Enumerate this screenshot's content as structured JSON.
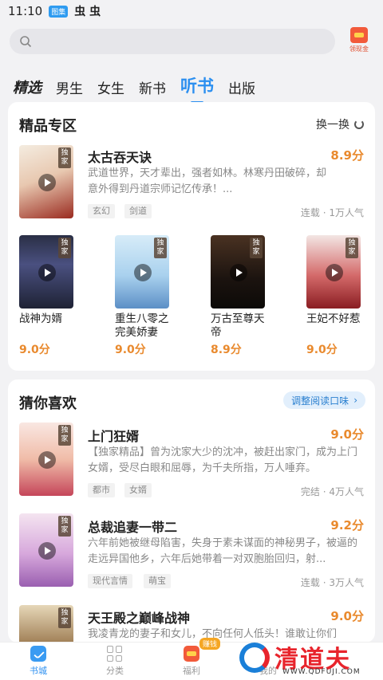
{
  "status_bar": {
    "time": "11:10",
    "app_tag": "图集",
    "icons": "虫 虫"
  },
  "search": {
    "placeholder": ""
  },
  "signin": {
    "label": "领现金"
  },
  "tabs": [
    {
      "label": "精选"
    },
    {
      "label": "男生"
    },
    {
      "label": "女生"
    },
    {
      "label": "新书"
    },
    {
      "label": "听书"
    },
    {
      "label": "出版"
    }
  ],
  "premium": {
    "title": "精品专区",
    "action": "换一换",
    "featured": {
      "title": "太古吞天诀",
      "score": "8.9分",
      "desc": "武道世界，天才辈出，强者如林。林寒丹田破碎，却意外得到丹道宗师记忆传承！...",
      "tags": [
        "玄幻",
        "剑道"
      ],
      "meta": "连载 · 1万人气",
      "exclusive": "独家"
    },
    "grid": [
      {
        "title": "战神为婿",
        "score": "9.0分",
        "exclusive": "独家"
      },
      {
        "title": "重生八零之完美娇妻",
        "score": "9.0分",
        "exclusive": "独家"
      },
      {
        "title": "万古至尊天帝",
        "score": "8.9分",
        "exclusive": "独家"
      },
      {
        "title": "王妃不好惹",
        "score": "9.0分",
        "exclusive": "独家"
      }
    ]
  },
  "recommend": {
    "title": "猜你喜欢",
    "action": "调整阅读口味",
    "books": [
      {
        "title": "上门狂婿",
        "score": "9.0分",
        "desc": "【独家精品】曾为沈家大少的沈冲，被赶出家门，成为上门女婿，受尽白眼和屈辱，为千夫所指，万人唾弃。",
        "tags": [
          "都市",
          "女婿"
        ],
        "meta": "完结 · 4万人气",
        "exclusive": "独家"
      },
      {
        "title": "总裁追妻一带二",
        "score": "9.2分",
        "desc": "六年前她被继母陷害，失身于素未谋面的神秘男子，被逼的走远异国他乡，六年后她带着一对双胞胎回归，射...",
        "tags": [
          "现代言情",
          "萌宝"
        ],
        "meta": "连载 · 3万人气",
        "exclusive": "独家"
      },
      {
        "title": "天王殿之巅峰战神",
        "score": "9.0分",
        "desc": "我凌青龙的妻子和女儿，不向任何人低头！谁敢让你们",
        "exclusive": "独家"
      }
    ]
  },
  "bottom_nav": [
    {
      "label": "书城"
    },
    {
      "label": "分类"
    },
    {
      "label": "福利"
    },
    {
      "label": "我的"
    }
  ],
  "bottom_badge": "赚钱",
  "watermark": {
    "text": "清道夫",
    "url": "WWW.QDFUJI.COM"
  }
}
